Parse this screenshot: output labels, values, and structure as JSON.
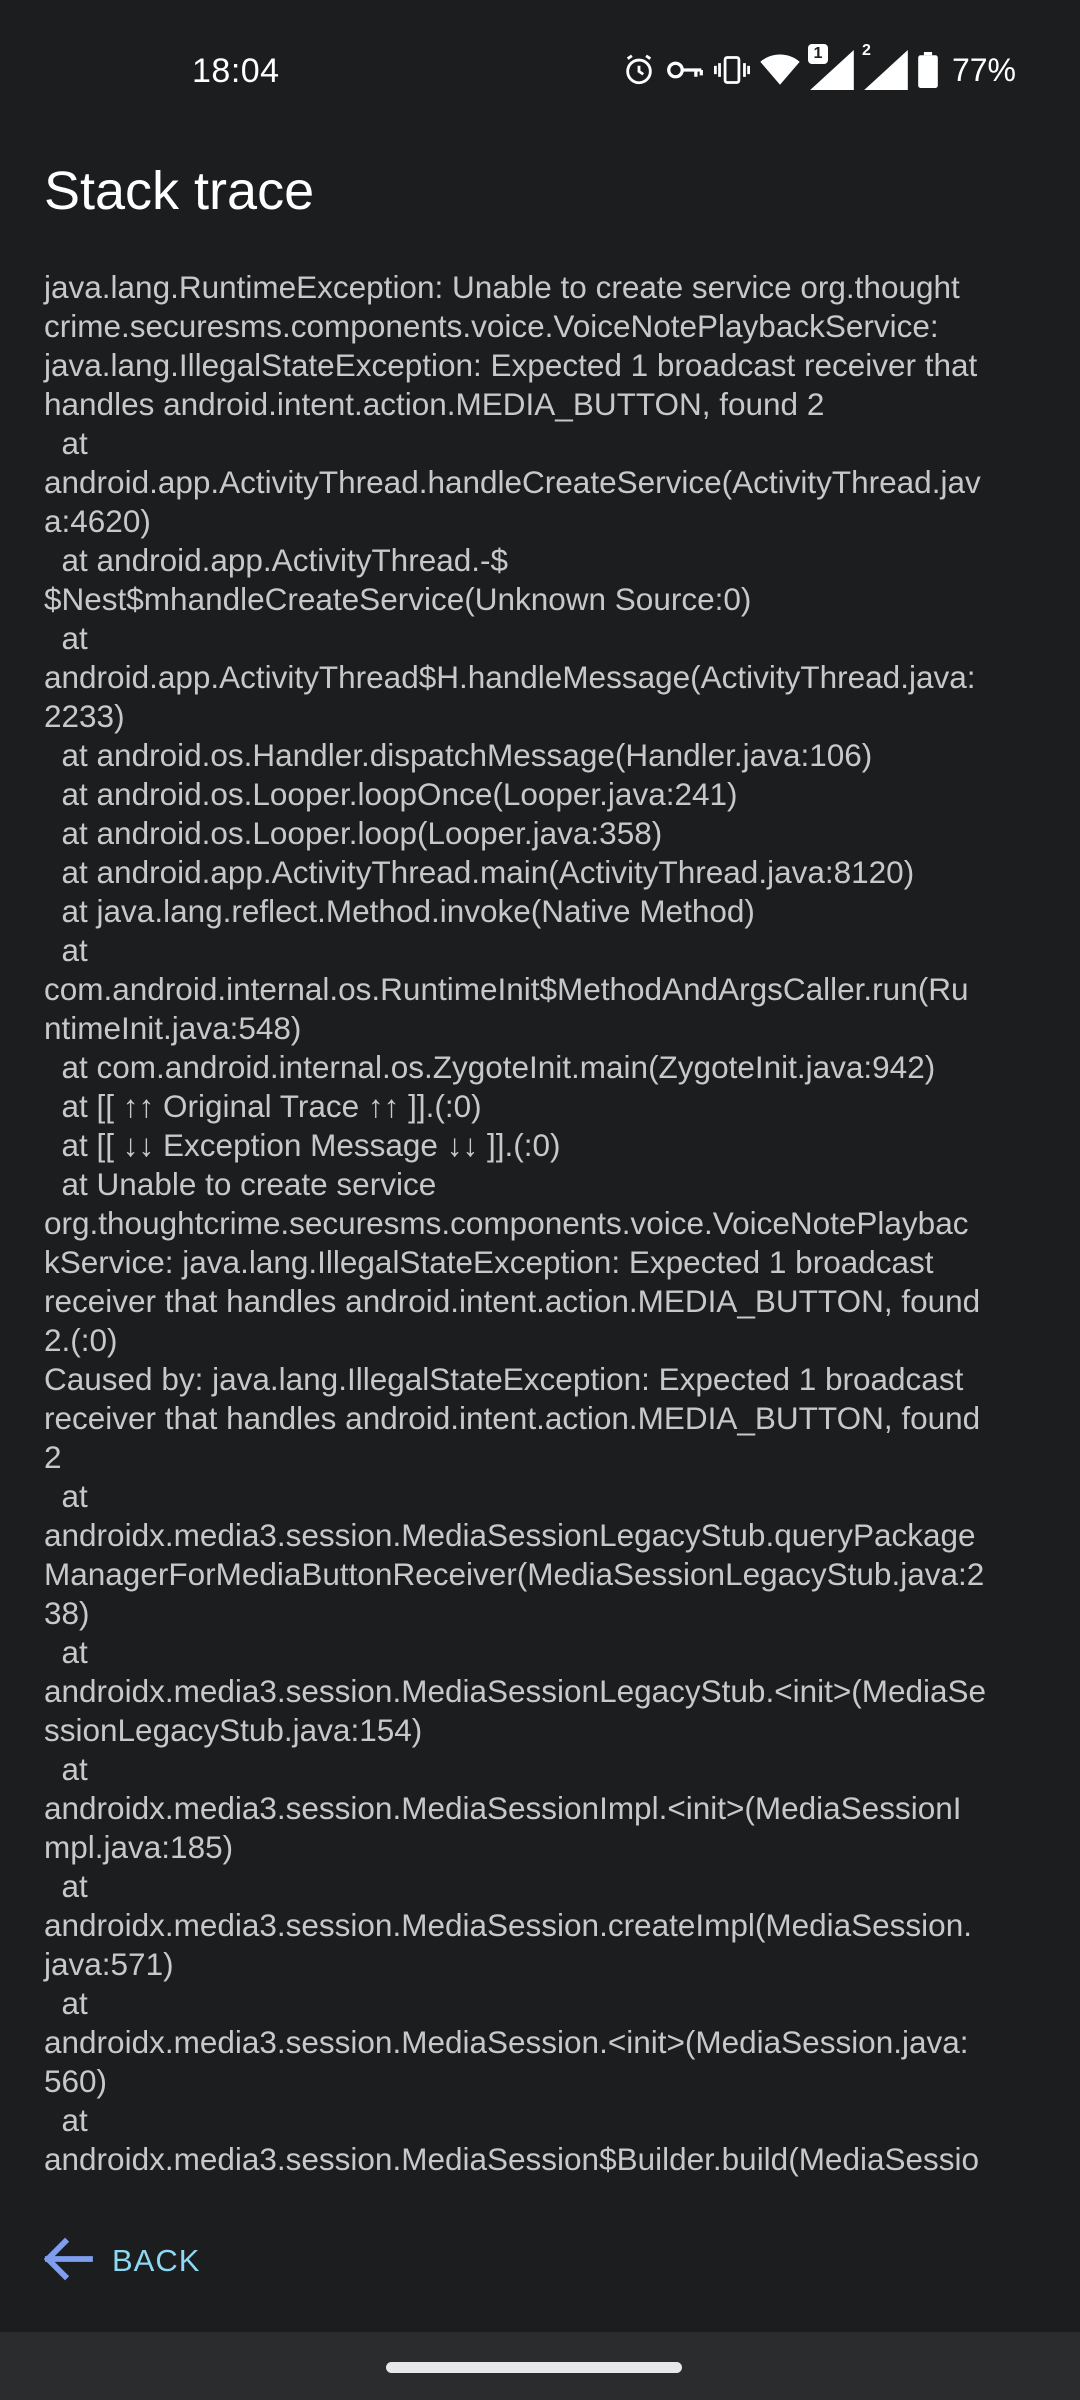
{
  "status_bar": {
    "time": "18:04",
    "battery_percent": "77%",
    "sim1_badge": "1",
    "sim2_badge": "2",
    "icons": [
      "alarm-icon",
      "vpn-key-icon",
      "vibrate-icon",
      "wifi-icon",
      "signal-icon",
      "signal-icon",
      "battery-icon"
    ]
  },
  "app_bar": {
    "title": "Stack trace"
  },
  "trace": {
    "lines": [
      "java.lang.RuntimeException: Unable to create service org.thought",
      "crime.securesms.components.voice.VoiceNotePlaybackService:",
      "java.lang.IllegalStateException: Expected 1 broadcast receiver that",
      "handles android.intent.action.MEDIA_BUTTON, found 2",
      "  at",
      "android.app.ActivityThread.handleCreateService(ActivityThread.jav",
      "a:4620)",
      "  at android.app.ActivityThread.-$",
      "$Nest$mhandleCreateService(Unknown Source:0)",
      "  at",
      "android.app.ActivityThread$H.handleMessage(ActivityThread.java:",
      "2233)",
      "  at android.os.Handler.dispatchMessage(Handler.java:106)",
      "  at android.os.Looper.loopOnce(Looper.java:241)",
      "  at android.os.Looper.loop(Looper.java:358)",
      "  at android.app.ActivityThread.main(ActivityThread.java:8120)",
      "  at java.lang.reflect.Method.invoke(Native Method)",
      "  at",
      "com.android.internal.os.RuntimeInit$MethodAndArgsCaller.run(Ru",
      "ntimeInit.java:548)",
      "  at com.android.internal.os.ZygoteInit.main(ZygoteInit.java:942)",
      "  at [[ ↑↑ Original Trace ↑↑ ]].(:0)",
      "  at [[ ↓↓ Exception Message ↓↓ ]].(:0)",
      "  at Unable to create service",
      "org.thoughtcrime.securesms.components.voice.VoiceNotePlaybac",
      "kService: java.lang.IllegalStateException: Expected 1 broadcast",
      "receiver that handles android.intent.action.MEDIA_BUTTON, found",
      "2.(:0)",
      "Caused by: java.lang.IllegalStateException: Expected 1 broadcast",
      "receiver that handles android.intent.action.MEDIA_BUTTON, found",
      "2",
      "  at",
      "androidx.media3.session.MediaSessionLegacyStub.queryPackage",
      "ManagerForMediaButtonReceiver(MediaSessionLegacyStub.java:2",
      "38)",
      "  at",
      "androidx.media3.session.MediaSessionLegacyStub.<init>(MediaSe",
      "ssionLegacyStub.java:154)",
      "  at",
      "androidx.media3.session.MediaSessionImpl.<init>(MediaSessionI",
      "mpl.java:185)",
      "  at",
      "androidx.media3.session.MediaSession.createImpl(MediaSession.",
      "java:571)",
      "  at",
      "androidx.media3.session.MediaSession.<init>(MediaSession.java:",
      "560)",
      "  at",
      "androidx.media3.session.MediaSession$Builder.build(MediaSessio"
    ]
  },
  "footer": {
    "back_label": "BACK"
  },
  "colors": {
    "background": "#1b1d1f",
    "trace_text": "#c6c8ca",
    "accent": "#8fd8f2",
    "back_arrow": "#7f9ef0"
  }
}
